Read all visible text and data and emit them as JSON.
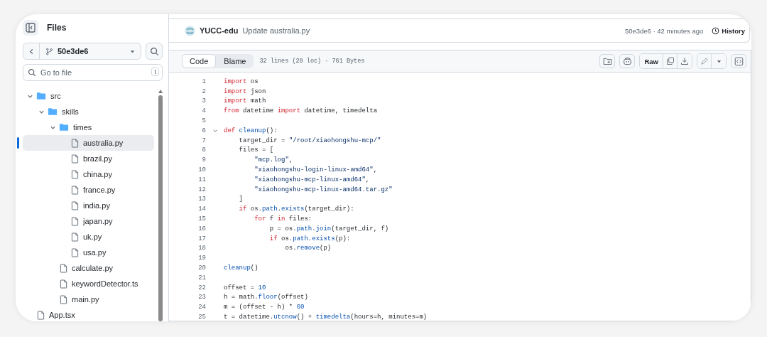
{
  "sidebar": {
    "title": "Files",
    "branch": "50e3de6",
    "search": {
      "placeholder": "Go to file",
      "shortcut": "t"
    },
    "tree": [
      {
        "name": "src",
        "kind": "folder",
        "expanded": true,
        "selected": false,
        "children": [
          {
            "name": "skills",
            "kind": "folder",
            "expanded": true,
            "selected": false,
            "children": [
              {
                "name": "times",
                "kind": "folder",
                "expanded": true,
                "selected": false,
                "children": [
                  {
                    "name": "australia.py",
                    "kind": "file",
                    "selected": true
                  },
                  {
                    "name": "brazil.py",
                    "kind": "file",
                    "selected": false
                  },
                  {
                    "name": "china.py",
                    "kind": "file",
                    "selected": false
                  },
                  {
                    "name": "france.py",
                    "kind": "file",
                    "selected": false
                  },
                  {
                    "name": "india.py",
                    "kind": "file",
                    "selected": false
                  },
                  {
                    "name": "japan.py",
                    "kind": "file",
                    "selected": false
                  },
                  {
                    "name": "uk.py",
                    "kind": "file",
                    "selected": false
                  },
                  {
                    "name": "usa.py",
                    "kind": "file",
                    "selected": false
                  }
                ]
              },
              {
                "name": "calculate.py",
                "kind": "file",
                "selected": false
              },
              {
                "name": "keywordDetector.ts",
                "kind": "file",
                "selected": false
              },
              {
                "name": "main.py",
                "kind": "file",
                "selected": false
              }
            ]
          }
        ]
      },
      {
        "name": "App.tsx",
        "kind": "file",
        "selected": false
      }
    ]
  },
  "commit": {
    "author": "YUCC-edu",
    "message": "Update australia.py",
    "hash_time": "50e3de6 · 42 minutes ago",
    "history": "History"
  },
  "toolbar": {
    "tabs": [
      {
        "label": "Code",
        "selected": true
      },
      {
        "label": "Blame",
        "selected": false
      }
    ],
    "info": "32 lines (28 loc) · 761 Bytes",
    "raw": "Raw"
  },
  "code": [
    {
      "n": "1",
      "tokens": [
        {
          "kind": "keyword",
          "text": "import"
        },
        {
          "kind": "plain",
          "text": " os"
        }
      ]
    },
    {
      "n": "2",
      "tokens": [
        {
          "kind": "keyword",
          "text": "import"
        },
        {
          "kind": "plain",
          "text": " json"
        }
      ]
    },
    {
      "n": "3",
      "tokens": [
        {
          "kind": "keyword",
          "text": "import"
        },
        {
          "kind": "plain",
          "text": " math"
        }
      ]
    },
    {
      "n": "4",
      "tokens": [
        {
          "kind": "keyword",
          "text": "from"
        },
        {
          "kind": "plain",
          "text": " datetime "
        },
        {
          "kind": "keyword",
          "text": "import"
        },
        {
          "kind": "plain",
          "text": " datetime, timedelta"
        }
      ]
    },
    {
      "n": "5"
    },
    {
      "n": "6",
      "fold": true,
      "tokens": [
        {
          "kind": "keyword",
          "text": "def"
        },
        {
          "kind": "function",
          "text": " cleanup"
        },
        {
          "kind": "plain",
          "text": "():"
        }
      ]
    },
    {
      "n": "7",
      "tokens": [
        {
          "kind": "plain",
          "text": "    target_dir = "
        },
        {
          "kind": "string",
          "text": "\"/root/xiaohongshu-mcp/\""
        }
      ]
    },
    {
      "n": "8",
      "tokens": [
        {
          "kind": "plain",
          "text": "    files = ["
        }
      ]
    },
    {
      "n": "9",
      "tokens": [
        {
          "kind": "string",
          "text": "        \"mcp.log\""
        },
        {
          "kind": "plain",
          "text": ","
        }
      ]
    },
    {
      "n": "10",
      "tokens": [
        {
          "kind": "string",
          "text": "        \"xiaohongshu-login-linux-amd64\""
        },
        {
          "kind": "plain",
          "text": ","
        }
      ]
    },
    {
      "n": "11",
      "tokens": [
        {
          "kind": "string",
          "text": "        \"xiaohongshu-mcp-linux-amd64\""
        },
        {
          "kind": "plain",
          "text": ","
        }
      ]
    },
    {
      "n": "12",
      "tokens": [
        {
          "kind": "string",
          "text": "        \"xiaohongshu-mcp-linux-amd64.tar.gz\""
        }
      ]
    },
    {
      "n": "13",
      "tokens": [
        {
          "kind": "plain",
          "text": "    ]"
        }
      ]
    },
    {
      "n": "14",
      "tokens": [
        {
          "kind": "keyword",
          "text": "    if"
        },
        {
          "kind": "plain",
          "text": " os."
        },
        {
          "kind": "function",
          "text": "path"
        },
        {
          "kind": "plain",
          "text": "."
        },
        {
          "kind": "function",
          "text": "exists"
        },
        {
          "kind": "plain",
          "text": "(target_dir):"
        }
      ]
    },
    {
      "n": "15",
      "tokens": [
        {
          "kind": "keyword",
          "text": "        for"
        },
        {
          "kind": "plain",
          "text": " f "
        },
        {
          "kind": "keyword",
          "text": "in"
        },
        {
          "kind": "plain",
          "text": " files:"
        }
      ]
    },
    {
      "n": "16",
      "tokens": [
        {
          "kind": "plain",
          "text": "            p = os."
        },
        {
          "kind": "function",
          "text": "path"
        },
        {
          "kind": "plain",
          "text": "."
        },
        {
          "kind": "function",
          "text": "join"
        },
        {
          "kind": "plain",
          "text": "(target_dir, f)"
        }
      ]
    },
    {
      "n": "17",
      "tokens": [
        {
          "kind": "keyword",
          "text": "            if"
        },
        {
          "kind": "plain",
          "text": " os."
        },
        {
          "kind": "function",
          "text": "path"
        },
        {
          "kind": "plain",
          "text": "."
        },
        {
          "kind": "function",
          "text": "exists"
        },
        {
          "kind": "plain",
          "text": "(p):"
        }
      ]
    },
    {
      "n": "18",
      "tokens": [
        {
          "kind": "plain",
          "text": "                os."
        },
        {
          "kind": "function",
          "text": "remove"
        },
        {
          "kind": "plain",
          "text": "(p)"
        }
      ]
    },
    {
      "n": "19"
    },
    {
      "n": "20",
      "tokens": [
        {
          "kind": "function",
          "text": "cleanup"
        },
        {
          "kind": "plain",
          "text": "()"
        }
      ]
    },
    {
      "n": "21"
    },
    {
      "n": "22",
      "tokens": [
        {
          "kind": "plain",
          "text": "offset = "
        },
        {
          "kind": "number",
          "text": "10"
        }
      ]
    },
    {
      "n": "23",
      "tokens": [
        {
          "kind": "plain",
          "text": "h = math."
        },
        {
          "kind": "function",
          "text": "floor"
        },
        {
          "kind": "plain",
          "text": "(offset)"
        }
      ]
    },
    {
      "n": "24",
      "tokens": [
        {
          "kind": "plain",
          "text": "m = (offset - h) * "
        },
        {
          "kind": "number",
          "text": "60"
        }
      ]
    },
    {
      "n": "25",
      "tokens": [
        {
          "kind": "plain",
          "text": "t = datetime."
        },
        {
          "kind": "function",
          "text": "utcnow"
        },
        {
          "kind": "plain",
          "text": "() + "
        },
        {
          "kind": "function",
          "text": "timedelta"
        },
        {
          "kind": "plain",
          "text": "(hours=h, minutes=m)"
        }
      ]
    }
  ]
}
